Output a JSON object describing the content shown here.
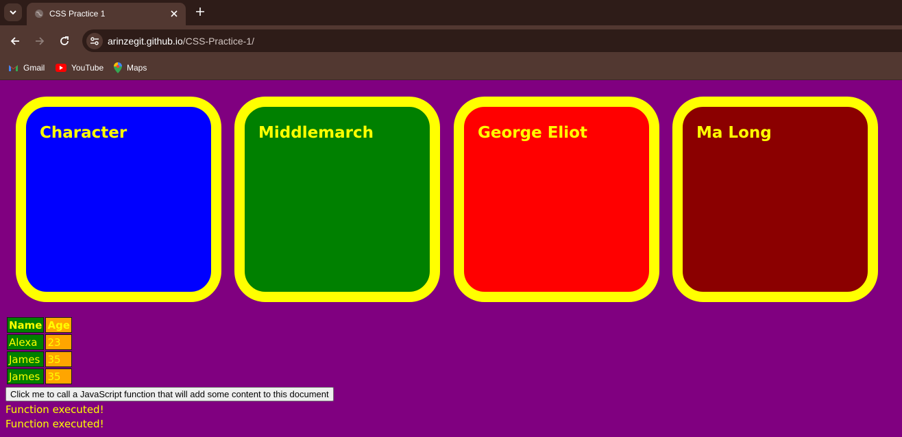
{
  "browser": {
    "tab": {
      "title": "CSS Practice 1",
      "favicon": "globe-icon"
    },
    "url": {
      "host": "arinzegit.github.io",
      "path": "/CSS-Practice-1/"
    },
    "bookmarks": [
      {
        "label": "Gmail",
        "icon": "gmail-icon"
      },
      {
        "label": "YouTube",
        "icon": "youtube-icon"
      },
      {
        "label": "Maps",
        "icon": "maps-icon"
      }
    ]
  },
  "colors": {
    "page_background": "#800080",
    "card_border": "#ffff00",
    "text": "#ffff00",
    "name_cell": "#008000",
    "age_cell": "#ffa500"
  },
  "cards": [
    {
      "title": "Character",
      "color": "#0000ff"
    },
    {
      "title": "Middlemarch",
      "color": "#008000"
    },
    {
      "title": "George Eliot",
      "color": "#ff0000"
    },
    {
      "title": "Ma Long",
      "color": "#8b0000"
    }
  ],
  "table": {
    "headers": [
      "Name",
      "Age"
    ],
    "rows": [
      [
        "Alexa",
        "23"
      ],
      [
        "James",
        "35"
      ],
      [
        "James",
        "35"
      ]
    ]
  },
  "button": {
    "label": "Click me to call a JavaScript function that will add some content to this document"
  },
  "output_lines": [
    "Function executed!",
    "Function executed!"
  ]
}
